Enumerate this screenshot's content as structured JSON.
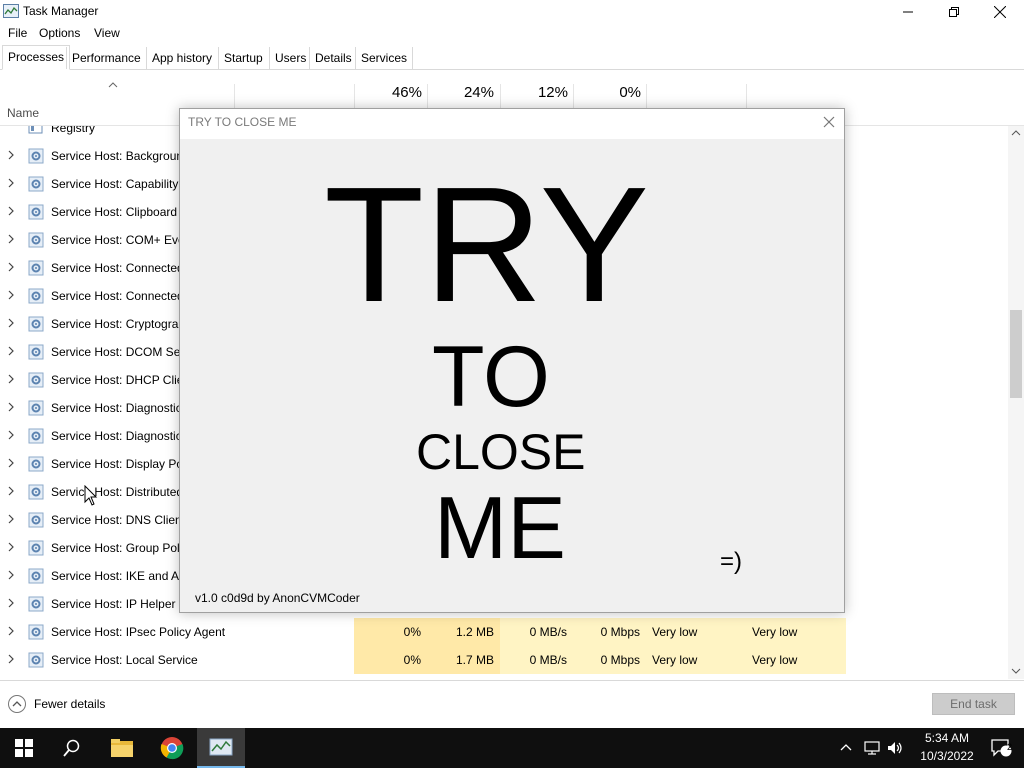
{
  "window": {
    "title": "Task Manager"
  },
  "menu": [
    "File",
    "Options",
    "View"
  ],
  "tabs": [
    "Processes",
    "Performance",
    "App history",
    "Startup",
    "Users",
    "Details",
    "Services"
  ],
  "header": {
    "name_label": "Name",
    "cpu_pct": "46%",
    "memory_pct": "24%",
    "disk_pct": "12%",
    "network_pct": "0%"
  },
  "rows": [
    {
      "name": "Registry"
    },
    {
      "name": "Service Host: Backgroun"
    },
    {
      "name": "Service Host: Capability A"
    },
    {
      "name": "Service Host: Clipboard U"
    },
    {
      "name": "Service Host: COM+ Eve"
    },
    {
      "name": "Service Host: Connected"
    },
    {
      "name": "Service Host: Connected"
    },
    {
      "name": "Service Host: Cryptograp"
    },
    {
      "name": "Service Host: DCOM Serv"
    },
    {
      "name": "Service Host: DHCP Clien"
    },
    {
      "name": "Service Host: Diagnostic"
    },
    {
      "name": "Service Host: Diagnostic"
    },
    {
      "name": "Service Host: Display Pol"
    },
    {
      "name": "Service Host: Distributed"
    },
    {
      "name": "Service Host: DNS Client"
    },
    {
      "name": "Service Host: Group Polic"
    },
    {
      "name": "Service Host: IKE and Au"
    },
    {
      "name": "Service Host: IP Helper"
    },
    {
      "name": "Service Host: IPsec Policy Agent",
      "cpu": "0%",
      "memory": "1.2 MB",
      "disk": "0 MB/s",
      "network": "0 Mbps",
      "power": "Very low",
      "power_trend": "Very low"
    },
    {
      "name": "Service Host: Local Service",
      "cpu": "0%",
      "memory": "1.7 MB",
      "disk": "0 MB/s",
      "network": "0 Mbps",
      "power": "Very low",
      "power_trend": "Very low"
    }
  ],
  "footer": {
    "fewer_details": "Fewer details",
    "end_task": "End task"
  },
  "popup": {
    "title": "TRY TO CLOSE ME",
    "word1": "TRY",
    "word2": "TO",
    "word3": "CLOSE",
    "word4": "ME",
    "smiley": "=)",
    "version": "v1.0 c0d9d by AnonCVMCoder"
  },
  "taskbar": {
    "time": "5:34 AM",
    "date": "10/3/2022",
    "notification_count": "2"
  },
  "icons": [
    "task-manager-icon",
    "gear-icon",
    "windows-start-icon",
    "search-icon",
    "file-explorer-icon",
    "chrome-icon",
    "network-icon",
    "volume-icon",
    "notification-icon"
  ]
}
